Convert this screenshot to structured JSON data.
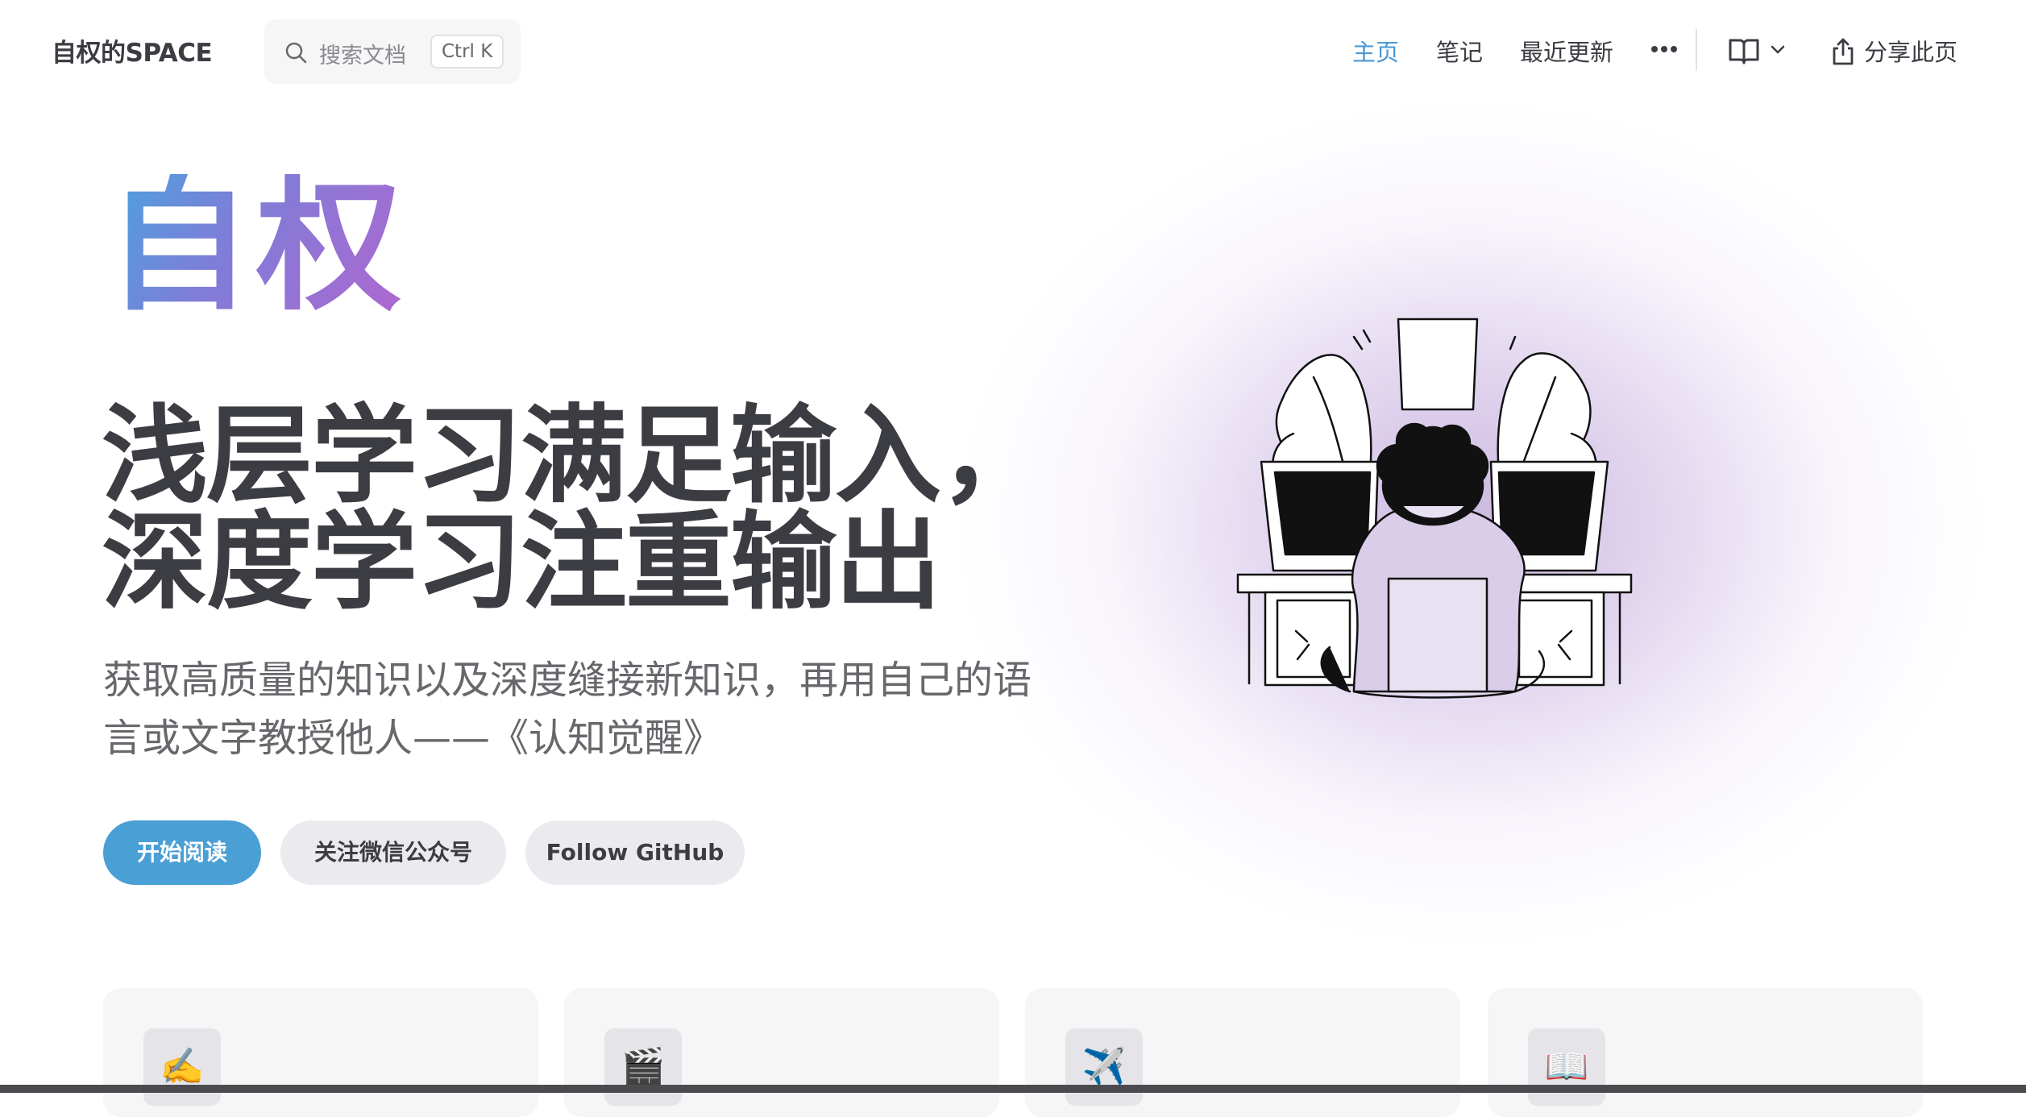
{
  "nav": {
    "brand": "自权的SPACE",
    "search_placeholder": "搜索文档",
    "search_shortcut": "Ctrl K",
    "links": [
      {
        "label": "主页",
        "active": true
      },
      {
        "label": "笔记",
        "active": false
      },
      {
        "label": "最近更新",
        "active": false
      }
    ],
    "more_icon": "more-horizontal-icon",
    "book_icon": "book-open-icon",
    "share_label": "分享此页"
  },
  "hero": {
    "name": "自权",
    "text_line1": "浅层学习满足输入，",
    "text_line2": "深度学习注重输出",
    "tagline": "获取高质量的知识以及深度缝接新知识，再用自己的语言或文字教授他人——《认知觉醒》",
    "actions": [
      "开始阅读",
      "关注微信公众号",
      "Follow GitHub"
    ]
  },
  "features": [
    {
      "icon": "✍️",
      "name": "writing-hand-icon"
    },
    {
      "icon": "🎬",
      "name": "clapper-board-icon"
    },
    {
      "icon": "✈️",
      "name": "airplane-icon"
    },
    {
      "icon": "📖",
      "name": "open-book-icon"
    }
  ],
  "colors": {
    "brand": "#4a9fd5",
    "text": "#3c3c43",
    "gradient_start": "#4aa3df",
    "gradient_end": "#b066d0"
  }
}
